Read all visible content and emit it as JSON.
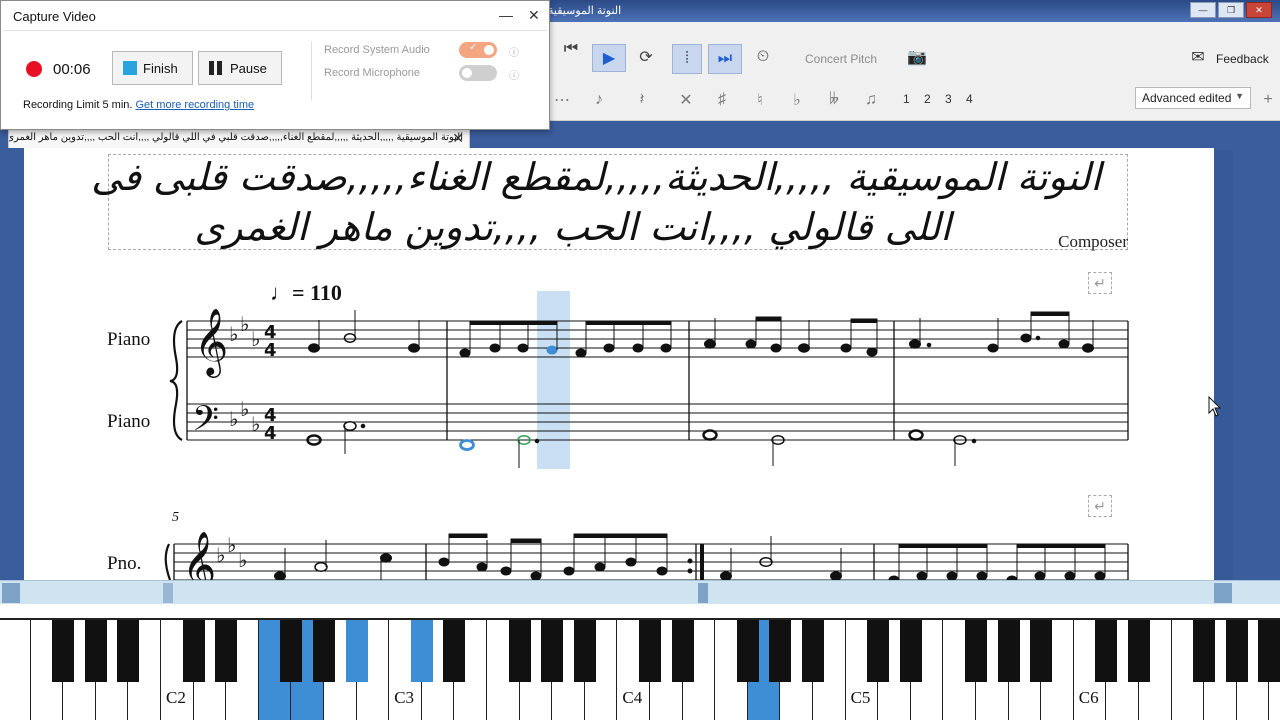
{
  "window": {
    "title_fragment": "النوتة الموسيقية"
  },
  "capture": {
    "title": "Capture Video",
    "minimize": "—",
    "close": "✕",
    "timer": "00:06",
    "finish_label": "Finish",
    "pause_label": "Pause",
    "limit_text": "Recording Limit 5 min.",
    "limit_link": "Get more recording time",
    "record_system_audio": "Record System Audio",
    "record_microphone": "Record Microphone",
    "system_audio_on": true,
    "microphone_on": false
  },
  "toolbar": {
    "concert_pitch": "Concert Pitch",
    "feedback": "Feedback",
    "voices": [
      "1",
      "2",
      "3",
      "4"
    ],
    "workspace_select": "Advanced edited"
  },
  "tab": {
    "label": "النوتة الموسيقية ,,,,,الحديثة ,,,,,لمقطع الغناء,,,,,صدقت قلبي في اللي قالولي ,,,,انت الحب ,,,,تدوين ماهر الغمرى"
  },
  "score": {
    "title_line1": "النوتة الموسيقية ,,,,,الحديثة,,,,,لمقطع الغناء,,,,,صدقت قلبى فى",
    "title_line2": "اللى قالولي ,,,,انت الحب ,,,,تدوين ماهر الغمرى",
    "composer": "Composer",
    "tempo": "= 110",
    "instrument_treble": "Piano",
    "instrument_bass": "Piano",
    "instrument_short": "Pno.",
    "measure_number": "5"
  },
  "piano": {
    "labels": [
      "C2",
      "C3",
      "C4",
      "C5",
      "C6"
    ]
  },
  "colors": {
    "selection": "#3e8ed6",
    "frame": "#3a5d9c",
    "record_red": "#e81123",
    "toggle_on": "#f4a582"
  }
}
